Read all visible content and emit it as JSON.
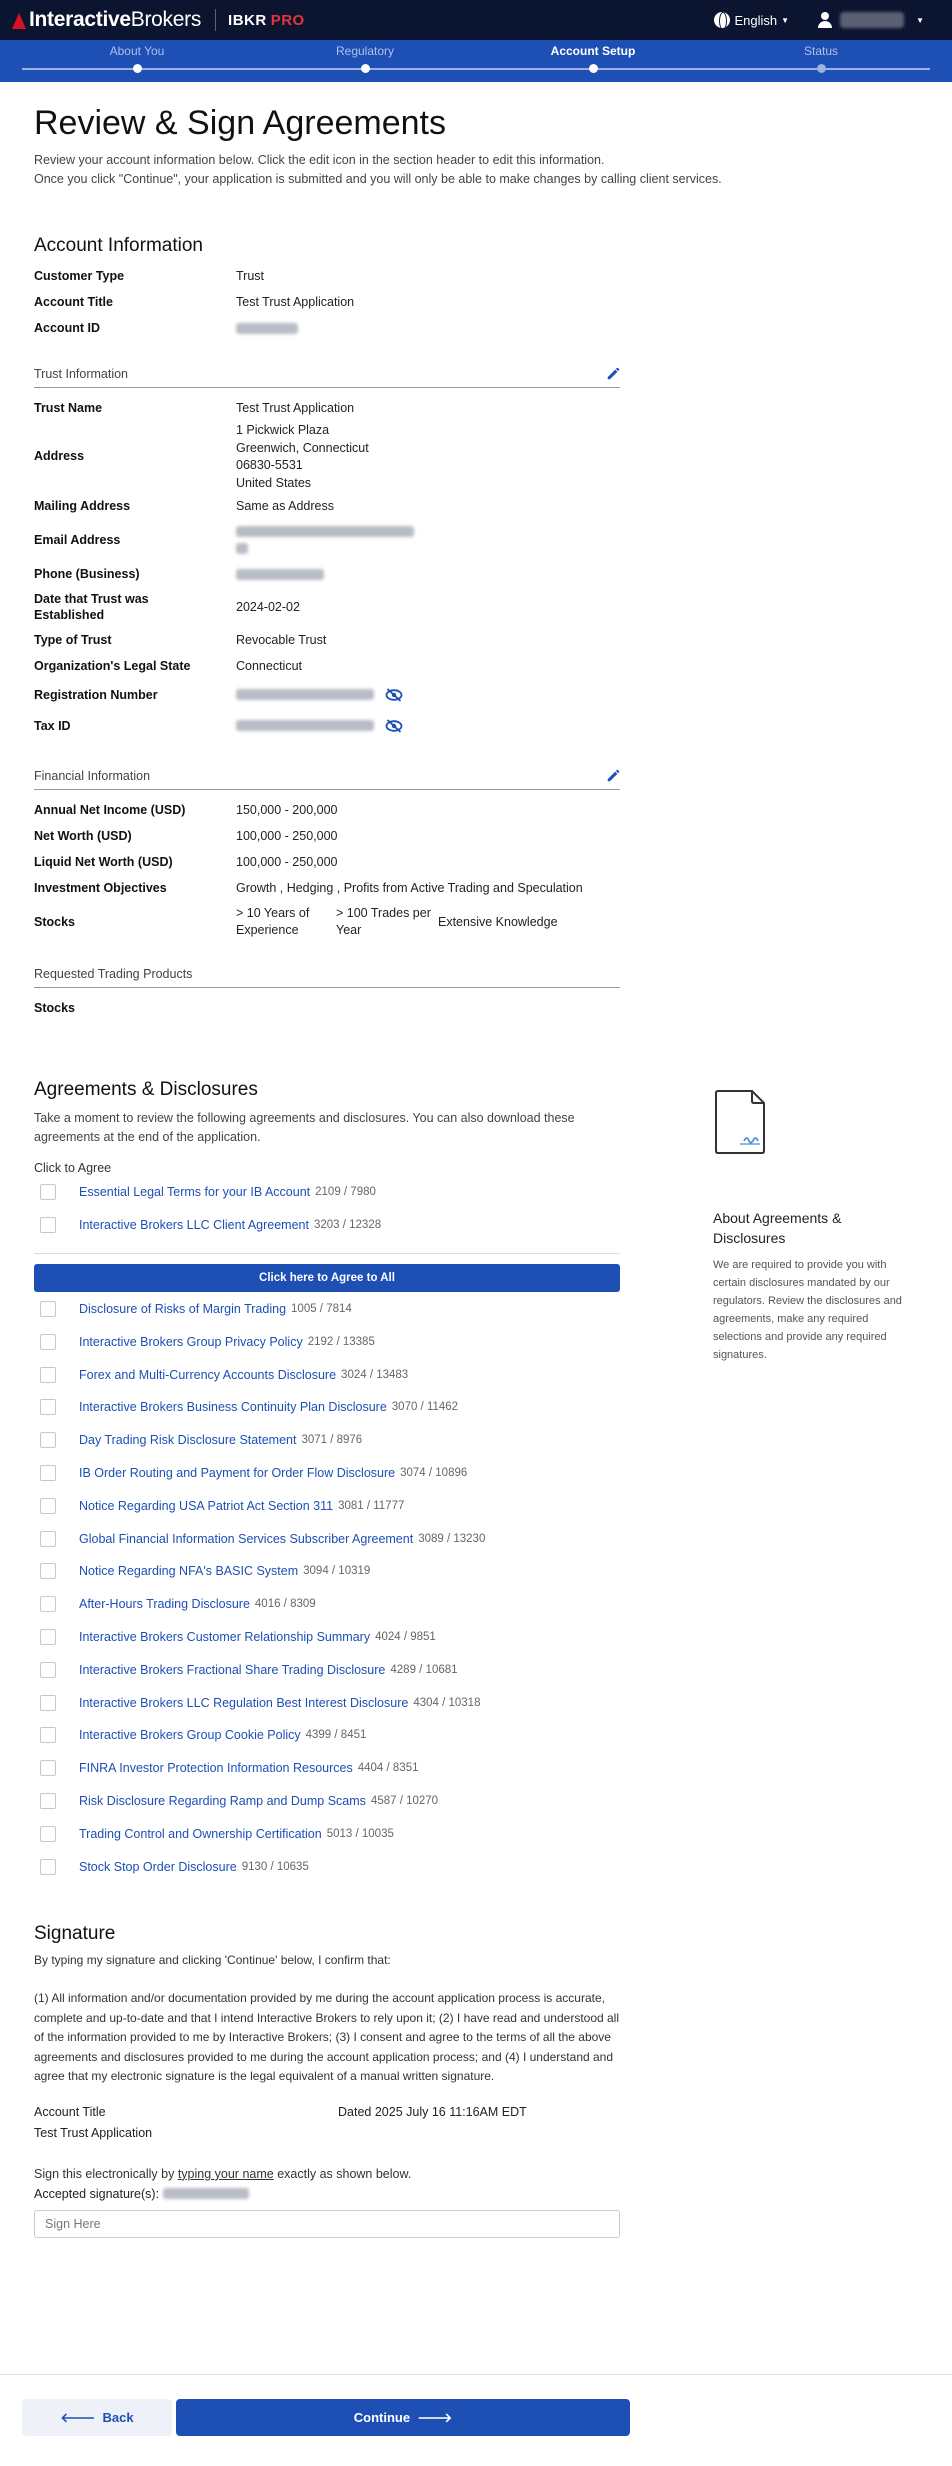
{
  "header": {
    "brand_bold": "Interactive",
    "brand_thin": "Brokers",
    "product": "IBKR",
    "product_tier": "PRO",
    "language": "English"
  },
  "stepper": {
    "steps": [
      {
        "label": "About You",
        "state": "complete"
      },
      {
        "label": "Regulatory",
        "state": "complete"
      },
      {
        "label": "Account Setup",
        "state": "active"
      },
      {
        "label": "Status",
        "state": "future"
      }
    ]
  },
  "page": {
    "title": "Review & Sign Agreements",
    "intro_line1": "Review your account information below. Click the edit icon in the section header to edit this information.",
    "intro_line2": "Once you click \"Continue\", your application is submitted and you will only be able to make changes by calling client services."
  },
  "account_info": {
    "heading": "Account Information",
    "rows": [
      {
        "label": "Customer Type",
        "value": "Trust"
      },
      {
        "label": "Account Title",
        "value": "Test Trust Application"
      },
      {
        "label": "Account ID",
        "value": ""
      }
    ]
  },
  "trust_info": {
    "heading": "Trust Information",
    "trust_name_label": "Trust Name",
    "trust_name": "Test Trust Application",
    "address_label": "Address",
    "address_lines": [
      "1 Pickwick Plaza",
      "Greenwich, Connecticut",
      "06830-5531",
      "United States"
    ],
    "mailing_label": "Mailing Address",
    "mailing_value": "Same as Address",
    "email_label": "Email Address",
    "phone_label": "Phone (Business)",
    "date_label": "Date that Trust was Established",
    "date_value": "2024-02-02",
    "type_label": "Type of Trust",
    "type_value": "Revocable Trust",
    "state_label": "Organization's Legal State",
    "state_value": "Connecticut",
    "reg_label": "Registration Number",
    "tax_label": "Tax ID"
  },
  "financial_info": {
    "heading": "Financial Information",
    "rows": [
      {
        "label": "Annual Net Income (USD)",
        "value": "150,000 - 200,000"
      },
      {
        "label": "Net Worth (USD)",
        "value": "100,000 - 250,000"
      },
      {
        "label": "Liquid Net Worth (USD)",
        "value": "100,000 - 250,000"
      },
      {
        "label": "Investment Objectives",
        "value": "Growth , Hedging , Profits from Active Trading and Speculation"
      }
    ],
    "stocks_label": "Stocks",
    "stocks_experience": "> 10 Years of Experience",
    "stocks_trades": "> 100 Trades per Year",
    "stocks_knowledge": "Extensive Knowledge"
  },
  "trading_products": {
    "heading": "Requested Trading Products",
    "item": "Stocks"
  },
  "agreements": {
    "heading": "Agreements & Disclosures",
    "description": "Take a moment to review the following agreements and disclosures. You can also download these agreements at the end of the application.",
    "click_to_agree": "Click to Agree",
    "agree_all_label": "Click here to Agree to All",
    "primary": [
      {
        "title": "Essential Legal Terms for your IB Account",
        "code": "2109 / 7980"
      },
      {
        "title": "Interactive Brokers LLC Client Agreement",
        "code": "3203 / 12328"
      }
    ],
    "items": [
      {
        "title": "Disclosure of Risks of Margin Trading",
        "code": "1005 / 7814"
      },
      {
        "title": "Interactive Brokers Group Privacy Policy",
        "code": "2192 / 13385"
      },
      {
        "title": "Forex and Multi-Currency Accounts Disclosure",
        "code": "3024 / 13483"
      },
      {
        "title": "Interactive Brokers Business Continuity Plan Disclosure",
        "code": "3070 / 11462"
      },
      {
        "title": "Day Trading Risk Disclosure Statement",
        "code": "3071 / 8976"
      },
      {
        "title": "IB Order Routing and Payment for Order Flow Disclosure",
        "code": "3074 / 10896"
      },
      {
        "title": "Notice Regarding USA Patriot Act Section 311",
        "code": "3081 / 11777"
      },
      {
        "title": "Global Financial Information Services Subscriber Agreement",
        "code": "3089 / 13230"
      },
      {
        "title": "Notice Regarding NFA's BASIC System",
        "code": "3094 / 10319"
      },
      {
        "title": "After-Hours Trading Disclosure",
        "code": "4016 / 8309"
      },
      {
        "title": "Interactive Brokers Customer Relationship Summary",
        "code": "4024 / 9851"
      },
      {
        "title": "Interactive Brokers Fractional Share Trading Disclosure",
        "code": "4289 / 10681"
      },
      {
        "title": "Interactive Brokers LLC Regulation Best Interest Disclosure",
        "code": "4304 / 10318"
      },
      {
        "title": "Interactive Brokers Group Cookie Policy",
        "code": "4399 / 8451"
      },
      {
        "title": "FINRA Investor Protection Information Resources",
        "code": "4404 / 8351"
      },
      {
        "title": "Risk Disclosure Regarding Ramp and Dump Scams",
        "code": "4587 / 10270"
      },
      {
        "title": "Trading Control and Ownership Certification",
        "code": "5013 / 10035"
      },
      {
        "title": "Stock Stop Order Disclosure",
        "code": "9130 / 10635"
      }
    ]
  },
  "about": {
    "title": "About Agreements & Disclosures",
    "text": "We are required to provide you with certain disclosures mandated by our regulators. Review the disclosures and agreements, make any required selections and provide any required signatures."
  },
  "signature": {
    "heading": "Signature",
    "intro": "By typing my signature and clicking 'Continue' below, I confirm that:",
    "terms": "(1) All information and/or documentation provided by me during the account application process is accurate, complete and up-to-date and that I intend Interactive Brokers to rely upon it; (2) I have read and understood all of the information provided to me by Interactive Brokers; (3) I consent and agree to the terms of all the above agreements and disclosures provided to me during the account application process; and (4) I understand and agree that my electronic signature is the legal equivalent of a manual written signature.",
    "account_title_label": "Account Title",
    "account_title_value": "Test Trust Application",
    "dated_label": "Dated",
    "dated_value": "2025 July 16 11:16AM EDT",
    "sign_prefix": "Sign this electronically by ",
    "sign_link": "typing your name",
    "sign_suffix": " exactly as shown below.",
    "accepted_label": "Accepted signature(s):",
    "placeholder": "Sign Here"
  },
  "footer": {
    "back_label": "Back",
    "continue_label": "Continue"
  },
  "colors": {
    "brand_blue": "#1d4fb5",
    "header_navy": "#0c1530",
    "pro_red": "#e3343e"
  }
}
